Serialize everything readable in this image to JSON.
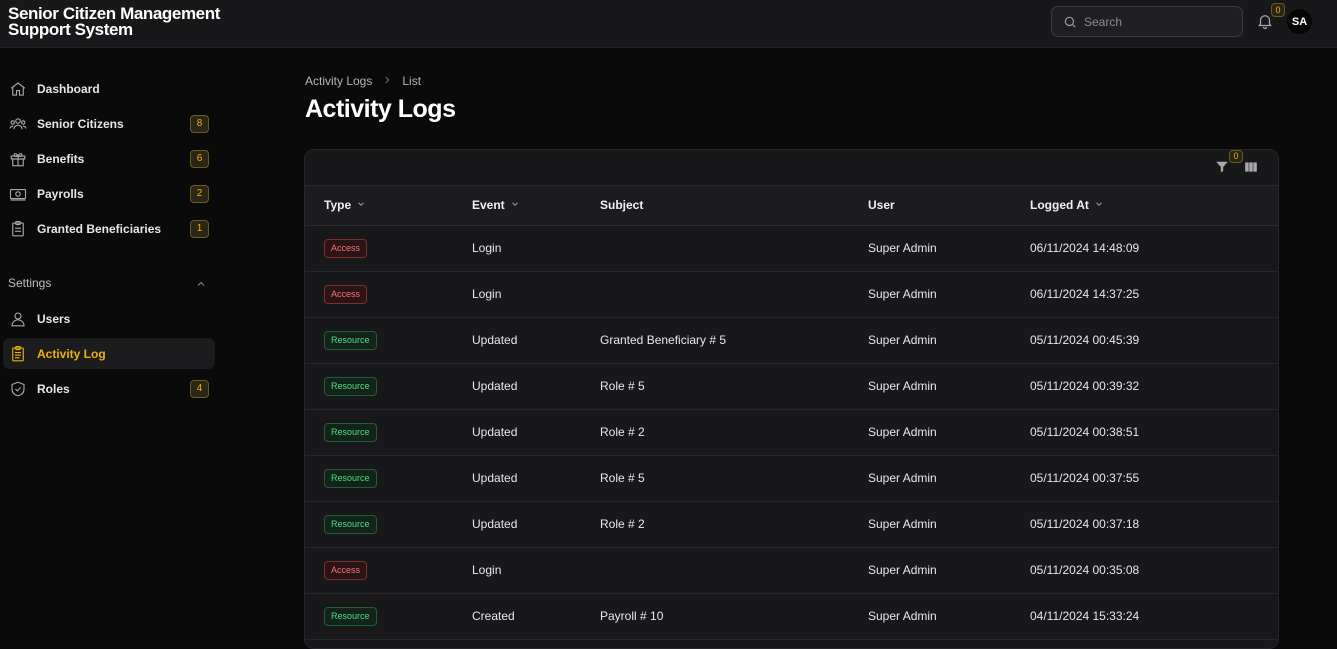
{
  "app": {
    "title": "Senior Citizen Management Support System"
  },
  "header": {
    "search_placeholder": "Search",
    "notifications_count": "0",
    "avatar_initials": "SA"
  },
  "sidebar": {
    "items": [
      {
        "label": "Dashboard",
        "icon": "home-icon",
        "count": null
      },
      {
        "label": "Senior Citizens",
        "icon": "users-icon",
        "count": "8"
      },
      {
        "label": "Benefits",
        "icon": "gift-icon",
        "count": "6"
      },
      {
        "label": "Payrolls",
        "icon": "cash-icon",
        "count": "2"
      },
      {
        "label": "Granted Beneficiaries",
        "icon": "clipboard-icon",
        "count": "1"
      }
    ],
    "settings_group": {
      "label": "Settings",
      "items": [
        {
          "label": "Users",
          "icon": "user-icon",
          "count": null
        },
        {
          "label": "Activity Log",
          "icon": "clipboard-list-icon",
          "count": null,
          "active": true
        },
        {
          "label": "Roles",
          "icon": "shield-icon",
          "count": "4"
        }
      ]
    }
  },
  "breadcrumb": {
    "items": [
      "Activity Logs",
      "List"
    ]
  },
  "page": {
    "title": "Activity Logs"
  },
  "table": {
    "filter_count": "0",
    "columns": [
      "Type",
      "Event",
      "Subject",
      "User",
      "Logged At"
    ],
    "rows": [
      {
        "type": "Access",
        "event": "Login",
        "subject": "",
        "user": "Super Admin",
        "logged_at": "06/11/2024 14:48:09"
      },
      {
        "type": "Access",
        "event": "Login",
        "subject": "",
        "user": "Super Admin",
        "logged_at": "06/11/2024 14:37:25"
      },
      {
        "type": "Resource",
        "event": "Updated",
        "subject": "Granted Beneficiary # 5",
        "user": "Super Admin",
        "logged_at": "05/11/2024 00:45:39"
      },
      {
        "type": "Resource",
        "event": "Updated",
        "subject": "Role # 5",
        "user": "Super Admin",
        "logged_at": "05/11/2024 00:39:32"
      },
      {
        "type": "Resource",
        "event": "Updated",
        "subject": "Role # 2",
        "user": "Super Admin",
        "logged_at": "05/11/2024 00:38:51"
      },
      {
        "type": "Resource",
        "event": "Updated",
        "subject": "Role # 5",
        "user": "Super Admin",
        "logged_at": "05/11/2024 00:37:55"
      },
      {
        "type": "Resource",
        "event": "Updated",
        "subject": "Role # 2",
        "user": "Super Admin",
        "logged_at": "05/11/2024 00:37:18"
      },
      {
        "type": "Access",
        "event": "Login",
        "subject": "",
        "user": "Super Admin",
        "logged_at": "05/11/2024 00:35:08"
      },
      {
        "type": "Resource",
        "event": "Created",
        "subject": "Payroll # 10",
        "user": "Super Admin",
        "logged_at": "04/11/2024 15:33:24"
      }
    ]
  },
  "colors": {
    "accent": "#eab308",
    "access_tag": "#f87171",
    "resource_tag": "#4ade80",
    "background": "#0a0a0b",
    "surface": "#18181b"
  }
}
